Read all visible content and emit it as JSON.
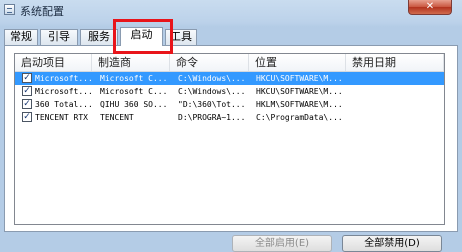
{
  "window": {
    "title": "系统配置",
    "close_glyph": "✕",
    "icon": "msconfig-icon"
  },
  "tabs": [
    {
      "label": "常规"
    },
    {
      "label": "引导"
    },
    {
      "label": "服务"
    },
    {
      "label": "启动",
      "active": true
    },
    {
      "label": "工具"
    }
  ],
  "highlight_color": "#e8141a",
  "table": {
    "headers": [
      "启动项目",
      "制造商",
      "命令",
      "位置",
      "禁用日期"
    ],
    "check_glyph": "✓",
    "rows": [
      {
        "selected": true,
        "checked": true,
        "item": "Microsoft...",
        "maker": "Microsoft C...",
        "command": "C:\\Windows\\...",
        "location": "HKCU\\SOFTWARE\\M...",
        "date": ""
      },
      {
        "selected": false,
        "checked": true,
        "item": "Microsoft...",
        "maker": "Microsoft C...",
        "command": "C:\\Windows\\...",
        "location": "HKCU\\SOFTWARE\\M...",
        "date": ""
      },
      {
        "selected": false,
        "checked": true,
        "item": "360 Total...",
        "maker": "QIHU 360 SO...",
        "command": "\"D:\\360\\Tot...",
        "location": "HKLM\\SOFTWARE\\M...",
        "date": ""
      },
      {
        "selected": false,
        "checked": true,
        "item": "TENCENT RTX",
        "maker": "TENCENT",
        "command": "D:\\PROGRA~1...",
        "location": "C:\\ProgramData\\...",
        "date": ""
      }
    ]
  },
  "buttons": {
    "enable_all": "全部启用(E)",
    "disable_all": "全部禁用(D)"
  },
  "colors": {
    "selection": "#3399ff"
  }
}
